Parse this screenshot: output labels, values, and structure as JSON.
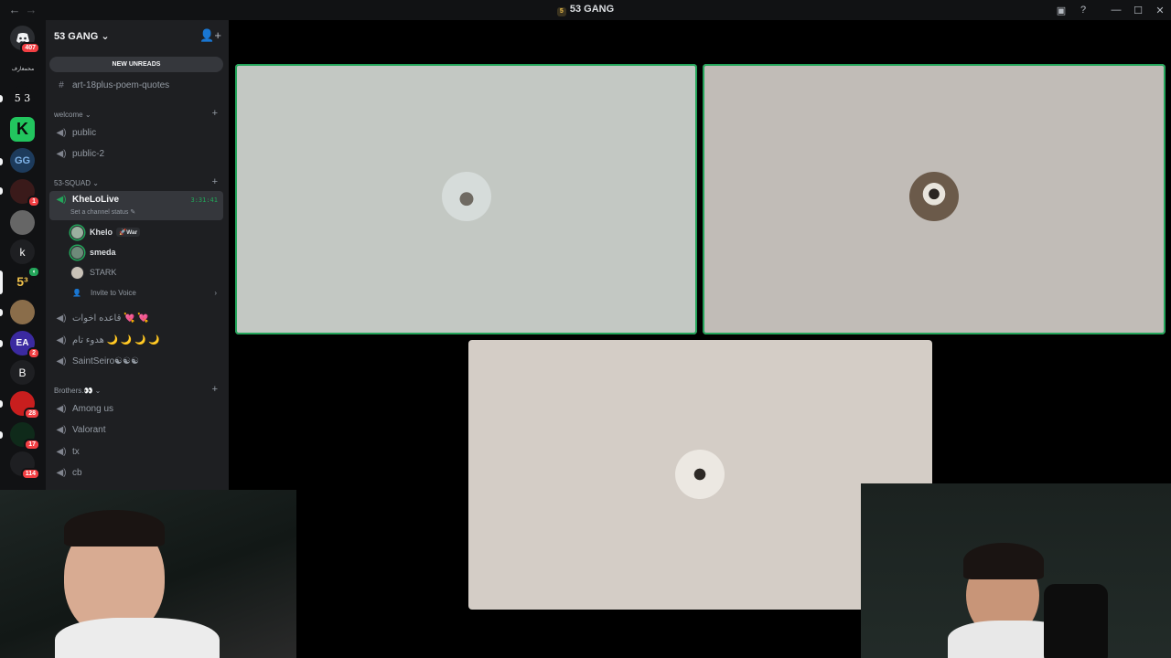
{
  "window": {
    "title": "53 GANG",
    "back_glyph": "←",
    "forward_glyph": "→",
    "inbox_glyph": "▣",
    "help_glyph": "?",
    "minimize_glyph": "—",
    "maximize_glyph": "☐",
    "close_glyph": "✕"
  },
  "guilds": {
    "home_badge": "407",
    "label_arabic": "محمعارف",
    "s53_label": "5 3",
    "k_label": "k",
    "b_label": "B",
    "badge_1": "1",
    "badge_2": "2",
    "badge_28": "28",
    "badge_17": "17",
    "badge_114": "114",
    "ea_label": "EA"
  },
  "sidebar": {
    "server_name": "53 GANG",
    "new_unreads": "NEW UNREADS",
    "top_channel": "art-18plus-poem-quotes",
    "categories": {
      "welcome": "welcome",
      "squad": "53-SQUAD",
      "brothers": "Brothers.👀"
    },
    "welcome_channels": [
      "public",
      "public-2"
    ],
    "active_channel": {
      "name": "KheLoLive",
      "time": "3:31:41",
      "status": "Set a channel status ✎"
    },
    "voice_users": [
      {
        "name": "Khelo",
        "tag": "🚀War"
      },
      {
        "name": "smeda",
        "tag": ""
      },
      {
        "name": "STARK",
        "tag": ""
      }
    ],
    "invite": "Invite to Voice",
    "squad_channels": [
      "قاعده اخوات 💘 💘",
      "هدوء تام 🌙 🌙 🌙 🌙",
      "SaintSeiro☯☯☯"
    ],
    "brothers_channels": [
      "Among us",
      "Valorant",
      "tx",
      "cb"
    ]
  },
  "colors": {
    "speaking": "#23a55a",
    "badge": "#f23f43",
    "sidebar_bg": "#1e1f22"
  }
}
